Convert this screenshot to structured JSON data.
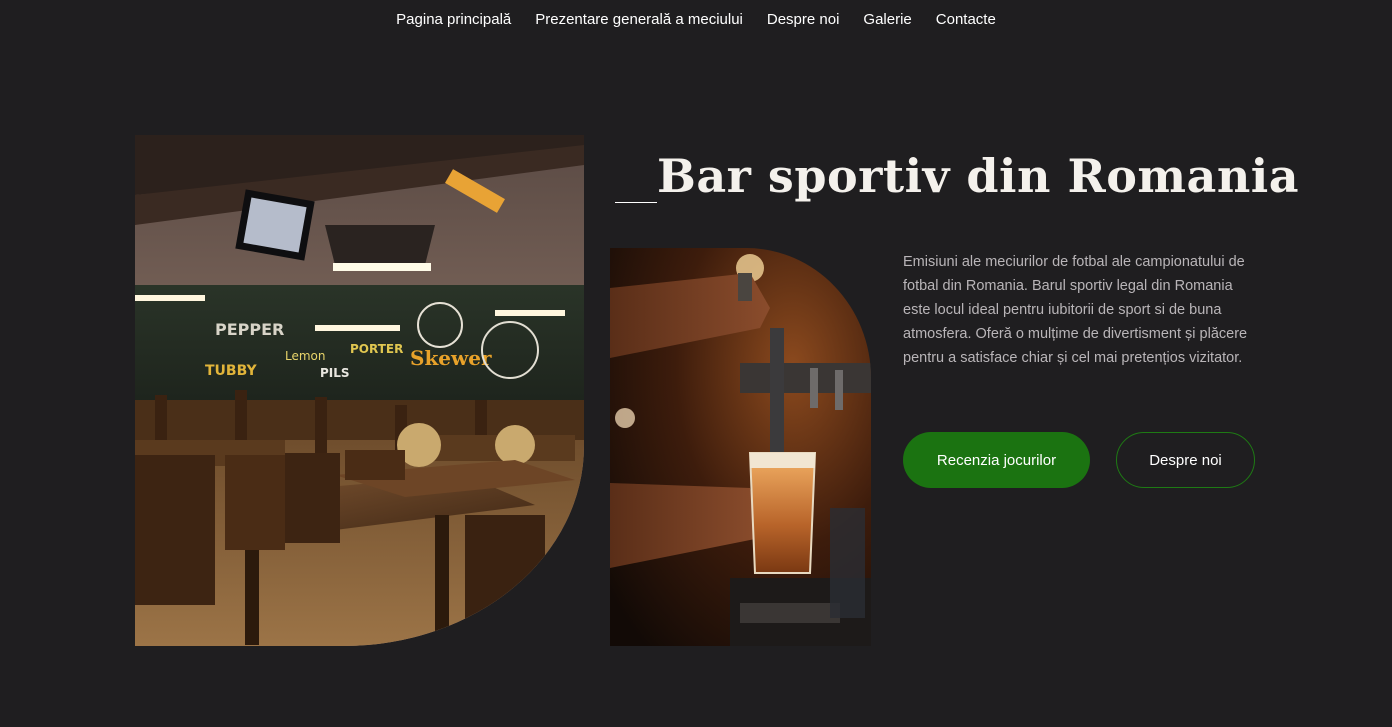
{
  "nav": {
    "items": [
      {
        "label": "Pagina principală"
      },
      {
        "label": "Prezentare generală a meciului"
      },
      {
        "label": "Despre noi"
      },
      {
        "label": "Galerie"
      },
      {
        "label": "Contacte"
      }
    ]
  },
  "hero": {
    "title": "Bar sportiv din Romania",
    "description": "Emisiuni ale meciurilor de fotbal ale campionatului de fotbal din Romania. Barul sportiv legal din Romania este locul ideal pentru iubitorii de sport si de buna atmosfera. Oferă o mulțime de divertisment și plăcere pentru a satisface chiar și cel mai pretențios vizitator.",
    "primary_button": "Recenzia jocurilor",
    "secondary_button": "Despre noi"
  },
  "images": {
    "bar_interior": "bar-interior-photo",
    "beer_pour": "beer-pour-photo"
  },
  "colors": {
    "background": "#1f1e20",
    "accent": "#1b7311",
    "text": "#ffffff",
    "muted": "#b9b5b8"
  }
}
